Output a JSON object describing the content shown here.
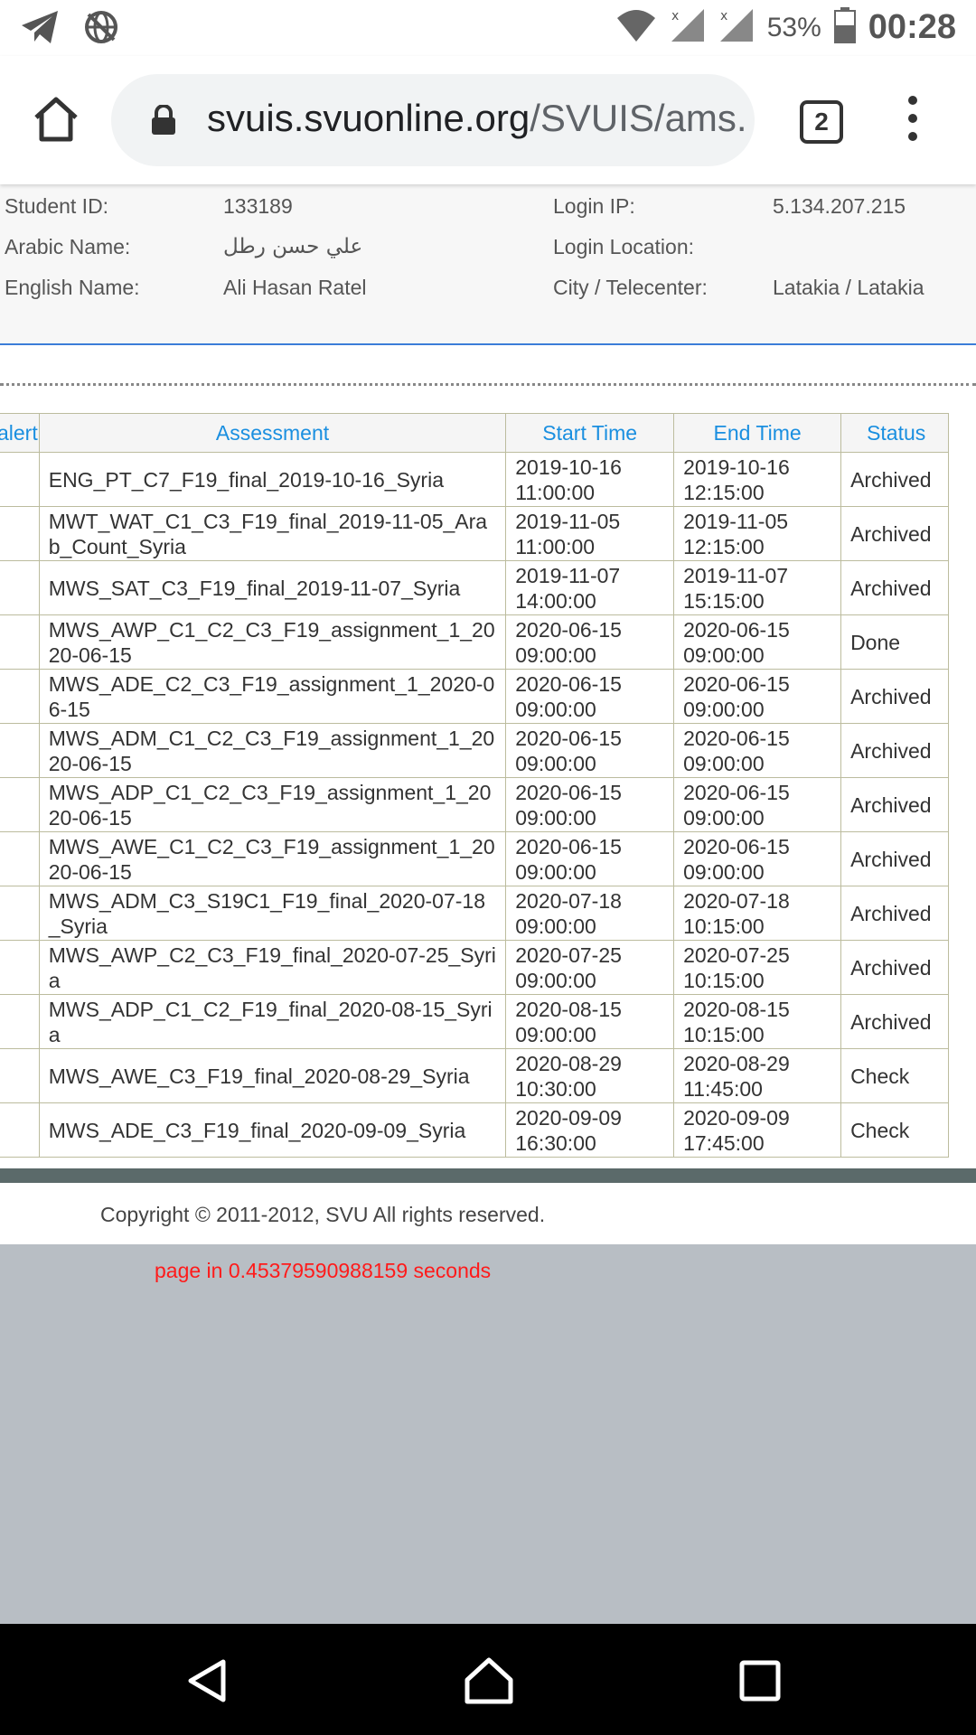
{
  "status_bar": {
    "battery_percent": "53%",
    "time": "00:28",
    "icons": [
      "telegram-icon",
      "globe-icon",
      "wifi-icon",
      "signal-icon",
      "signal-icon",
      "battery-icon"
    ]
  },
  "browser": {
    "url_host": "svuis.svuonline.org",
    "url_path": "/SVUIS/ams.",
    "tab_count": "2"
  },
  "student_info": {
    "student_id_label": "Student ID:",
    "student_id": "133189",
    "arabic_name_label": "Arabic Name:",
    "arabic_name": "علي حسن رطل",
    "english_name_label": "English Name:",
    "english_name": "Ali Hasan Ratel",
    "login_ip_label": "Login IP:",
    "login_ip": "5.134.207.215",
    "login_location_label": "Login Location:",
    "login_location": "",
    "city_label": "City / Telecenter:",
    "city": "Latakia / Latakia"
  },
  "table": {
    "headers": [
      "alert",
      "Assessment",
      "Start Time",
      "End Time",
      "Status"
    ],
    "rows": [
      {
        "assessment": "ENG_PT_C7_F19_final_2019-10-16_Syria",
        "start_date": "2019-10-16",
        "start_time": "11:00:00",
        "end_date": "2019-10-16",
        "end_time": "12:15:00",
        "status": "Archived"
      },
      {
        "assessment": "MWT_WAT_C1_C3_F19_final_2019-11-05_Arab_Count_Syria",
        "start_date": "2019-11-05",
        "start_time": "11:00:00",
        "end_date": "2019-11-05",
        "end_time": "12:15:00",
        "status": "Archived"
      },
      {
        "assessment": "MWS_SAT_C3_F19_final_2019-11-07_Syria",
        "start_date": "2019-11-07",
        "start_time": "14:00:00",
        "end_date": "2019-11-07",
        "end_time": "15:15:00",
        "status": "Archived"
      },
      {
        "assessment": "MWS_AWP_C1_C2_C3_F19_assignment_1_2020-06-15",
        "start_date": "2020-06-15",
        "start_time": "09:00:00",
        "end_date": "2020-06-15",
        "end_time": "09:00:00",
        "status": "Done"
      },
      {
        "assessment": "MWS_ADE_C2_C3_F19_assignment_1_2020-06-15",
        "start_date": "2020-06-15",
        "start_time": "09:00:00",
        "end_date": "2020-06-15",
        "end_time": "09:00:00",
        "status": "Archived"
      },
      {
        "assessment": "MWS_ADM_C1_C2_C3_F19_assignment_1_2020-06-15",
        "start_date": "2020-06-15",
        "start_time": "09:00:00",
        "end_date": "2020-06-15",
        "end_time": "09:00:00",
        "status": "Archived"
      },
      {
        "assessment": "MWS_ADP_C1_C2_C3_F19_assignment_1_2020-06-15",
        "start_date": "2020-06-15",
        "start_time": "09:00:00",
        "end_date": "2020-06-15",
        "end_time": "09:00:00",
        "status": "Archived"
      },
      {
        "assessment": "MWS_AWE_C1_C2_C3_F19_assignment_1_2020-06-15",
        "start_date": "2020-06-15",
        "start_time": "09:00:00",
        "end_date": "2020-06-15",
        "end_time": "09:00:00",
        "status": "Archived"
      },
      {
        "assessment": "MWS_ADM_C3_S19C1_F19_final_2020-07-18_Syria",
        "start_date": "2020-07-18",
        "start_time": "09:00:00",
        "end_date": "2020-07-18",
        "end_time": "10:15:00",
        "status": "Archived"
      },
      {
        "assessment": "MWS_AWP_C2_C3_F19_final_2020-07-25_Syria",
        "start_date": "2020-07-25",
        "start_time": "09:00:00",
        "end_date": "2020-07-25",
        "end_time": "10:15:00",
        "status": "Archived"
      },
      {
        "assessment": "MWS_ADP_C1_C2_F19_final_2020-08-15_Syria",
        "start_date": "2020-08-15",
        "start_time": "09:00:00",
        "end_date": "2020-08-15",
        "end_time": "10:15:00",
        "status": "Archived"
      },
      {
        "assessment": "MWS_AWE_C3_F19_final_2020-08-29_Syria",
        "start_date": "2020-08-29",
        "start_time": "10:30:00",
        "end_date": "2020-08-29",
        "end_time": "11:45:00",
        "status": "Check"
      },
      {
        "assessment": "MWS_ADE_C3_F19_final_2020-09-09_Syria",
        "start_date": "2020-09-09",
        "start_time": "16:30:00",
        "end_date": "2020-09-09",
        "end_time": "17:45:00",
        "status": "Check"
      }
    ]
  },
  "footer": {
    "copyright": "Copyright © 2011-2012, SVU All rights reserved.",
    "timing": "page in 0.45379590988159 seconds"
  },
  "colors": {
    "header_text": "#1a8fe0",
    "status_done": "#2e9f2e",
    "status_check": "#1a1aff",
    "timing_text": "#ff1a1a",
    "info_divider": "#3b7dd8"
  }
}
